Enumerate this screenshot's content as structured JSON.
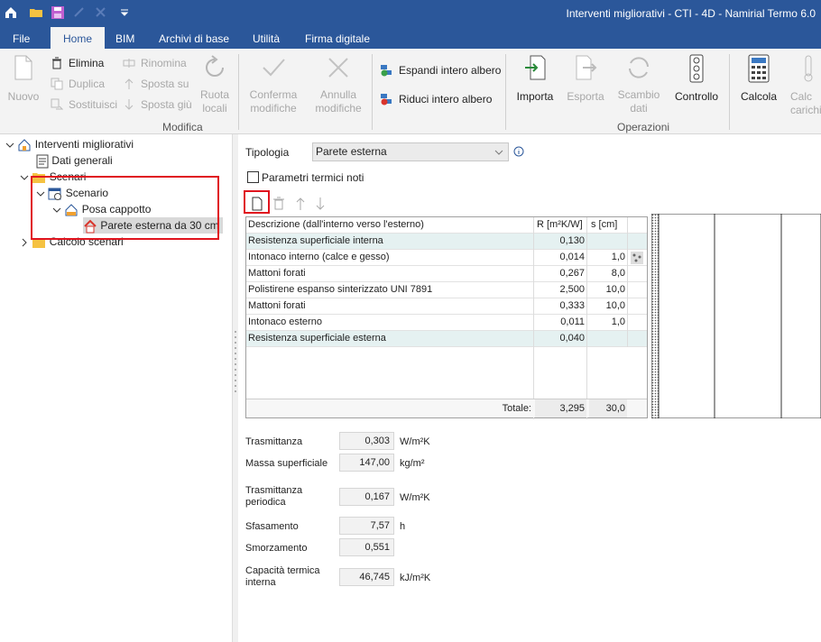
{
  "window": {
    "title": "Interventi migliorativi - CTI - 4D - Namirial Termo 6.0"
  },
  "menu": [
    "File",
    "Home",
    "BIM",
    "Archivi di base",
    "Utilità",
    "Firma digitale"
  ],
  "ribbon": {
    "nuovo": "Nuovo",
    "elimina": "Elimina",
    "duplica": "Duplica",
    "sostituisci": "Sostituisci",
    "rinomina": "Rinomina",
    "sposta_su": "Sposta su",
    "sposta_giu": "Sposta giù",
    "ruota_1": "Ruota",
    "ruota_2": "locali",
    "conferma_1": "Conferma",
    "conferma_2": "modifiche",
    "annulla_1": "Annulla",
    "annulla_2": "modifiche",
    "espandi": "Espandi intero albero",
    "riduci": "Riduci intero albero",
    "importa": "Importa",
    "esporta": "Esporta",
    "scambio_1": "Scambio",
    "scambio_2": "dati",
    "controllo": "Controllo",
    "calcola": "Calcola",
    "calcola_carichi_1": "Calc",
    "calcola_carichi_2": "carichi",
    "group_modifica": "Modifica",
    "group_operazioni": "Operazioni"
  },
  "tree": {
    "root": "Interventi migliorativi",
    "dati_generali": "Dati generali",
    "scenari": "Scenari",
    "scenario": "Scenario",
    "posa": "Posa cappotto",
    "parete": "Parete esterna da 30 cm",
    "calcolo": "Calcolo scenari"
  },
  "form": {
    "tipologia_label": "Tipologia",
    "tipologia_value": "Parete esterna",
    "param_label": "Parametri termici noti"
  },
  "table": {
    "headers": [
      "Descrizione (dall'interno verso l'esterno)",
      "R [m²K/W]",
      "s [cm]"
    ],
    "rows": [
      {
        "desc": "Resistenza superficiale interna",
        "r": "0,130",
        "s": ""
      },
      {
        "desc": "Intonaco interno (calce e gesso)",
        "r": "0,014",
        "s": "1,0"
      },
      {
        "desc": "Mattoni forati",
        "r": "0,267",
        "s": "8,0"
      },
      {
        "desc": "Polistirene espanso sinterizzato UNI 7891",
        "r": "2,500",
        "s": "10,0"
      },
      {
        "desc": "Mattoni forati",
        "r": "0,333",
        "s": "10,0"
      },
      {
        "desc": "Intonaco esterno",
        "r": "0,011",
        "s": "1,0"
      },
      {
        "desc": "Resistenza superficiale esterna",
        "r": "0,040",
        "s": ""
      }
    ],
    "totale_label": "Totale:",
    "totale_r": "3,295",
    "totale_s": "30,0"
  },
  "results": {
    "trasm_label": "Trasmittanza",
    "trasm_value": "0,303",
    "trasm_unit": "W/m²K",
    "massa_label": "Massa superficiale",
    "massa_value": "147,00",
    "massa_unit": "kg/m²",
    "trasm_per_label_1": "Trasmittanza",
    "trasm_per_label_2": "periodica",
    "trasm_per_value": "0,167",
    "trasm_per_unit": "W/m²K",
    "sfas_label": "Sfasamento",
    "sfas_value": "7,57",
    "sfas_unit": "h",
    "smorz_label": "Smorzamento",
    "smorz_value": "0,551",
    "cap_label_1": "Capacità termica",
    "cap_label_2": "interna",
    "cap_value": "46,745",
    "cap_unit": "kJ/m²K"
  },
  "colors": {
    "titlebar": "#2b579a",
    "highlight_row": "#e5f1f1",
    "callout": "#e0141e"
  }
}
